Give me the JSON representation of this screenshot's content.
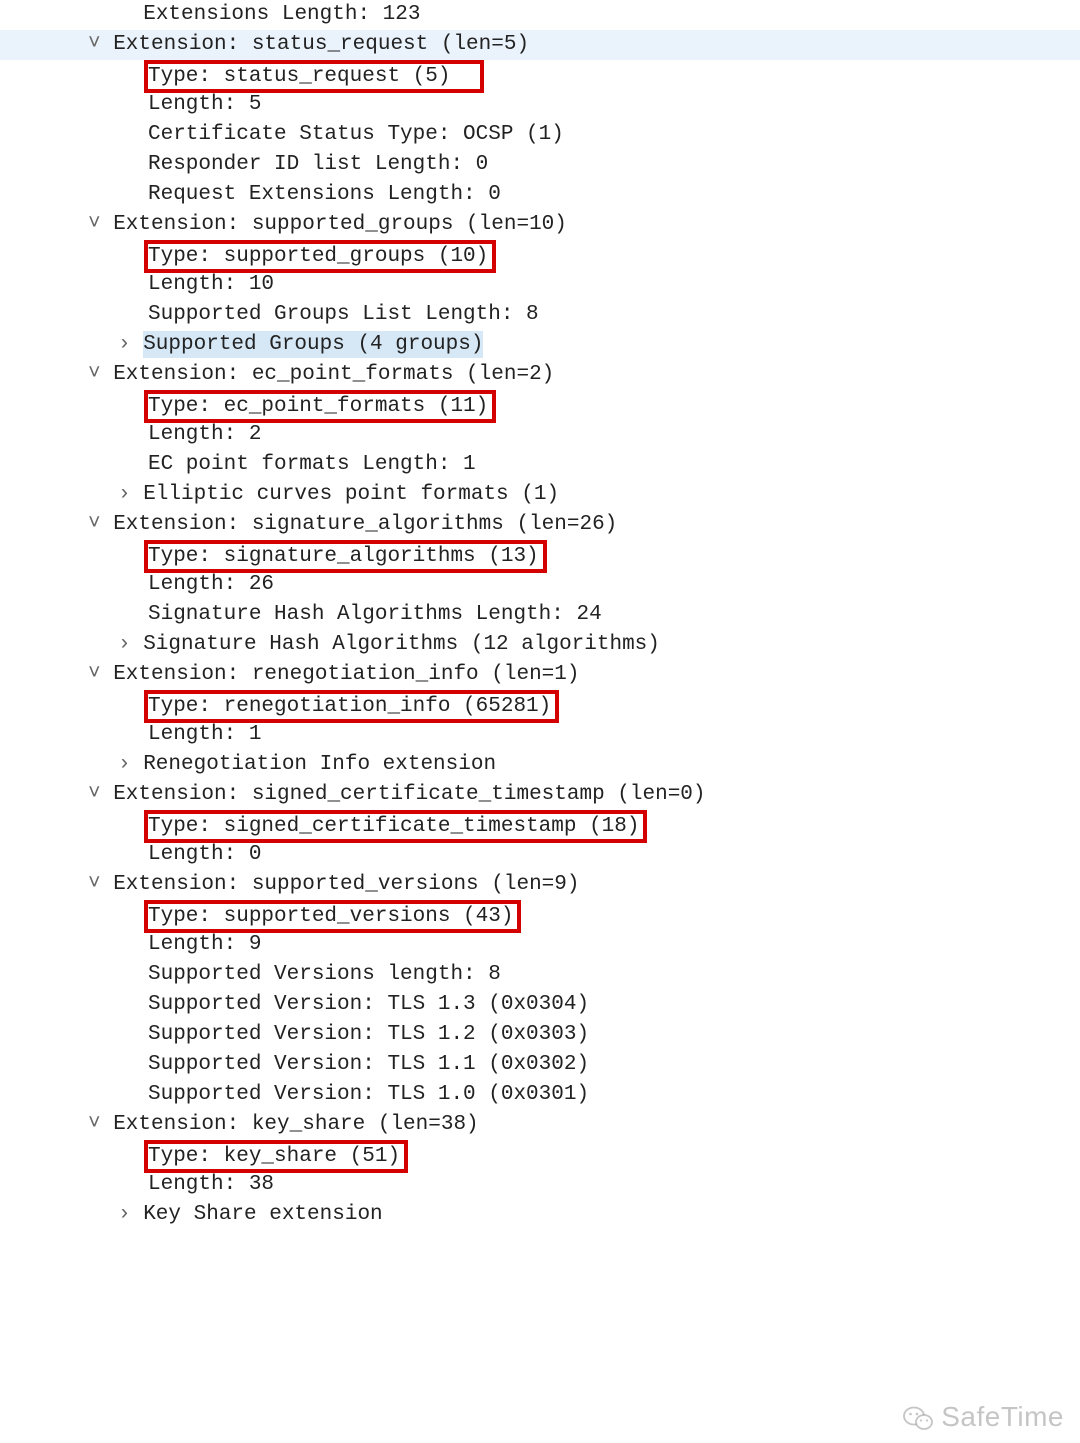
{
  "top": {
    "ext_len": "Extensions Length: 123"
  },
  "ext": [
    {
      "title": "Extension: status_request (len=5)",
      "type": "Type: status_request (5)",
      "children": [
        "Length: 5",
        "Certificate Status Type: OCSP (1)",
        "Responder ID list Length: 0",
        "Request Extensions Length: 0"
      ]
    },
    {
      "title": "Extension: supported_groups (len=10)",
      "type": "Type: supported_groups (10)",
      "children": [
        "Length: 10",
        "Supported Groups List Length: 8"
      ],
      "collapsed": "Supported Groups (4 groups)"
    },
    {
      "title": "Extension: ec_point_formats (len=2)",
      "type": "Type: ec_point_formats (11)",
      "children": [
        "Length: 2",
        "EC point formats Length: 1"
      ],
      "collapsed": "Elliptic curves point formats (1)"
    },
    {
      "title": "Extension: signature_algorithms (len=26)",
      "type": "Type: signature_algorithms (13)",
      "children": [
        "Length: 26",
        "Signature Hash Algorithms Length: 24"
      ],
      "collapsed": "Signature Hash Algorithms (12 algorithms)"
    },
    {
      "title": "Extension: renegotiation_info (len=1)",
      "type": "Type: renegotiation_info (65281)",
      "children": [
        "Length: 1"
      ],
      "collapsed": "Renegotiation Info extension"
    },
    {
      "title": "Extension: signed_certificate_timestamp (len=0)",
      "type": "Type: signed_certificate_timestamp (18)",
      "children": [
        "Length: 0"
      ]
    },
    {
      "title": "Extension: supported_versions (len=9)",
      "type": "Type: supported_versions (43)",
      "children": [
        "Length: 9",
        "Supported Versions length: 8",
        "Supported Version: TLS 1.3 (0x0304)",
        "Supported Version: TLS 1.2 (0x0303)",
        "Supported Version: TLS 1.1 (0x0302)",
        "Supported Version: TLS 1.0 (0x0301)"
      ]
    },
    {
      "title": "Extension: key_share (len=38)",
      "type": "Type: key_share (51)",
      "children": [
        "Length: 38"
      ],
      "collapsed": "Key Share extension"
    }
  ],
  "watermark": "SafeTime"
}
